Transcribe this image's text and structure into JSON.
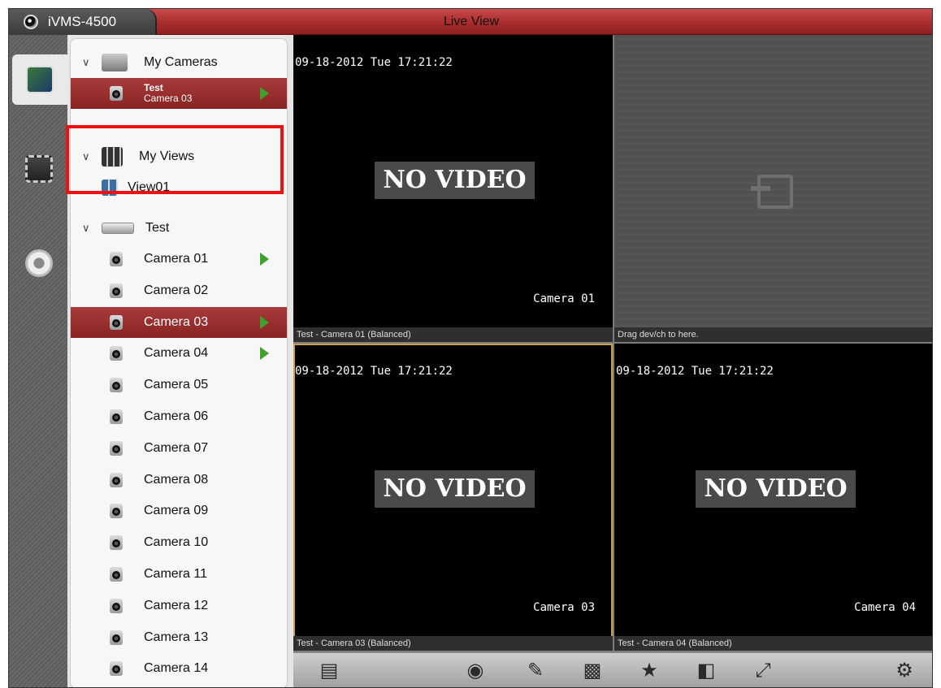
{
  "app": {
    "name": "iVMS-4500",
    "title": "Live View"
  },
  "rail": [
    {
      "icon": "live-view-icon",
      "active": true
    },
    {
      "icon": "playback-icon",
      "active": false
    },
    {
      "icon": "settings-icon",
      "active": false
    }
  ],
  "tree": {
    "my_cameras": {
      "label": "My Cameras",
      "item": {
        "device": "Test",
        "channel": "Camera 03"
      }
    },
    "my_views": {
      "label": "My Views",
      "item": "View01"
    },
    "device": {
      "label": "Test"
    },
    "cameras": [
      "Camera 01",
      "Camera 02",
      "Camera 03",
      "Camera 04",
      "Camera 05",
      "Camera 06",
      "Camera 07",
      "Camera 08",
      "Camera 09",
      "Camera 10",
      "Camera 11",
      "Camera 12",
      "Camera 13",
      "Camera 14"
    ]
  },
  "tiles": [
    {
      "timestamp": "09-18-2012 Tue 17:21:22",
      "status": "NO VIDEO",
      "overlay": "Camera 01",
      "caption": "Test - Camera 01 (Balanced)"
    },
    {
      "caption": "Drag dev/ch to here."
    },
    {
      "timestamp": "09-18-2012 Tue 17:21:22",
      "status": "NO VIDEO",
      "overlay": "Camera 03",
      "caption": "Test - Camera 03 (Balanced)"
    },
    {
      "timestamp": "09-18-2012 Tue 17:21:22",
      "status": "NO VIDEO",
      "overlay": "Camera 04",
      "caption": "Test - Camera 04 (Balanced)"
    }
  ],
  "toolbar": [
    "stop-all-icon",
    "snapshot-icon",
    "mic-icon",
    "quality-icon",
    "favorite-icon",
    "close-window-icon",
    "fullscreen-icon",
    "ptz-icon"
  ]
}
